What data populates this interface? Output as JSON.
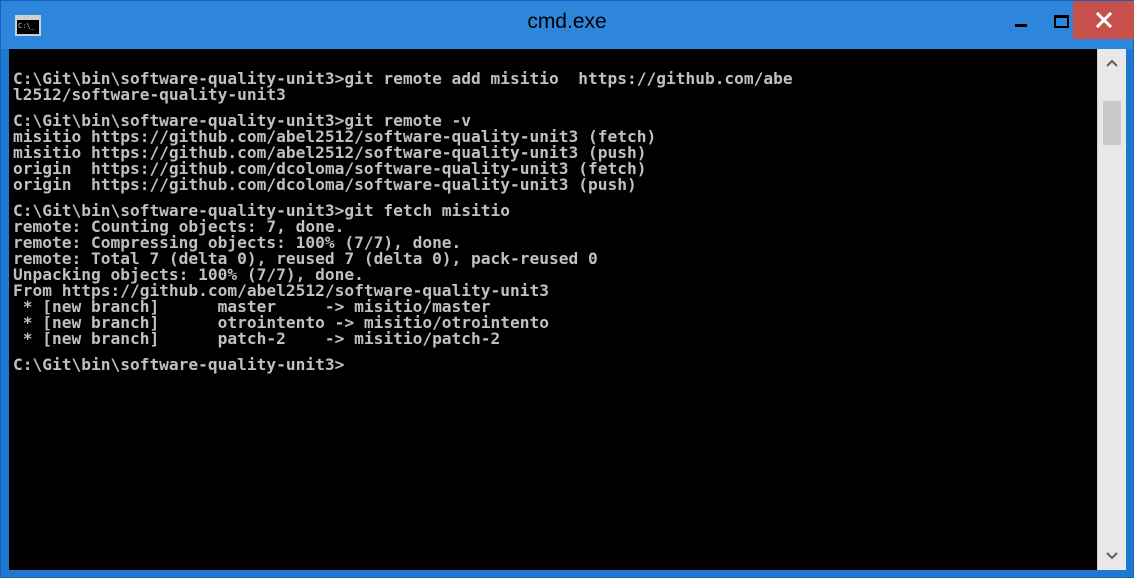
{
  "window": {
    "title": "cmd.exe",
    "icon": "cmd-icon",
    "icon_text": "C:\\_",
    "controls": {
      "minimize": "minimize-icon",
      "maximize": "maximize-icon",
      "close": "close-icon"
    },
    "colors": {
      "titlebar": "#2d86dc",
      "close_button": "#c7514a",
      "console_background": "#000000",
      "console_text": "#c0c0c0"
    }
  },
  "console": {
    "lines": [
      "C:\\Git\\bin\\software-quality-unit3>git remote add misitio  https://github.com/abe",
      "l2512/software-quality-unit3",
      "",
      "C:\\Git\\bin\\software-quality-unit3>git remote -v",
      "misitio https://github.com/abel2512/software-quality-unit3 (fetch)",
      "misitio https://github.com/abel2512/software-quality-unit3 (push)",
      "origin  https://github.com/dcoloma/software-quality-unit3 (fetch)",
      "origin  https://github.com/dcoloma/software-quality-unit3 (push)",
      "",
      "C:\\Git\\bin\\software-quality-unit3>git fetch misitio",
      "remote: Counting objects: 7, done.",
      "remote: Compressing objects: 100% (7/7), done.",
      "remote: Total 7 (delta 0), reused 7 (delta 0), pack-reused 0",
      "Unpacking objects: 100% (7/7), done.",
      "From https://github.com/abel2512/software-quality-unit3",
      " * [new branch]      master     -> misitio/master",
      " * [new branch]      otrointento -> misitio/otrointento",
      " * [new branch]      patch-2    -> misitio/patch-2",
      "",
      "C:\\Git\\bin\\software-quality-unit3>"
    ]
  },
  "scrollbar": {
    "up_icon": "scroll-up-arrow-icon",
    "down_icon": "scroll-down-arrow-icon"
  }
}
